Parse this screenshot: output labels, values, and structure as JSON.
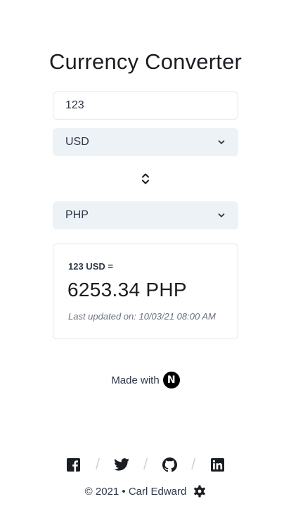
{
  "title": "Currency Converter",
  "amount": {
    "value": "123"
  },
  "from_currency": {
    "selected": "USD"
  },
  "to_currency": {
    "selected": "PHP"
  },
  "result": {
    "from_text": "123 USD =",
    "to_text": "6253.34 PHP",
    "updated": "Last updated on: 10/03/21 08:00 AM"
  },
  "made_with": {
    "label": "Made with",
    "logo_letter": "N"
  },
  "social": {
    "separator": "/",
    "icons": [
      "facebook-icon",
      "twitter-icon",
      "github-icon",
      "linkedin-icon"
    ]
  },
  "footer": {
    "text": "© 2021 • Carl Edward"
  }
}
